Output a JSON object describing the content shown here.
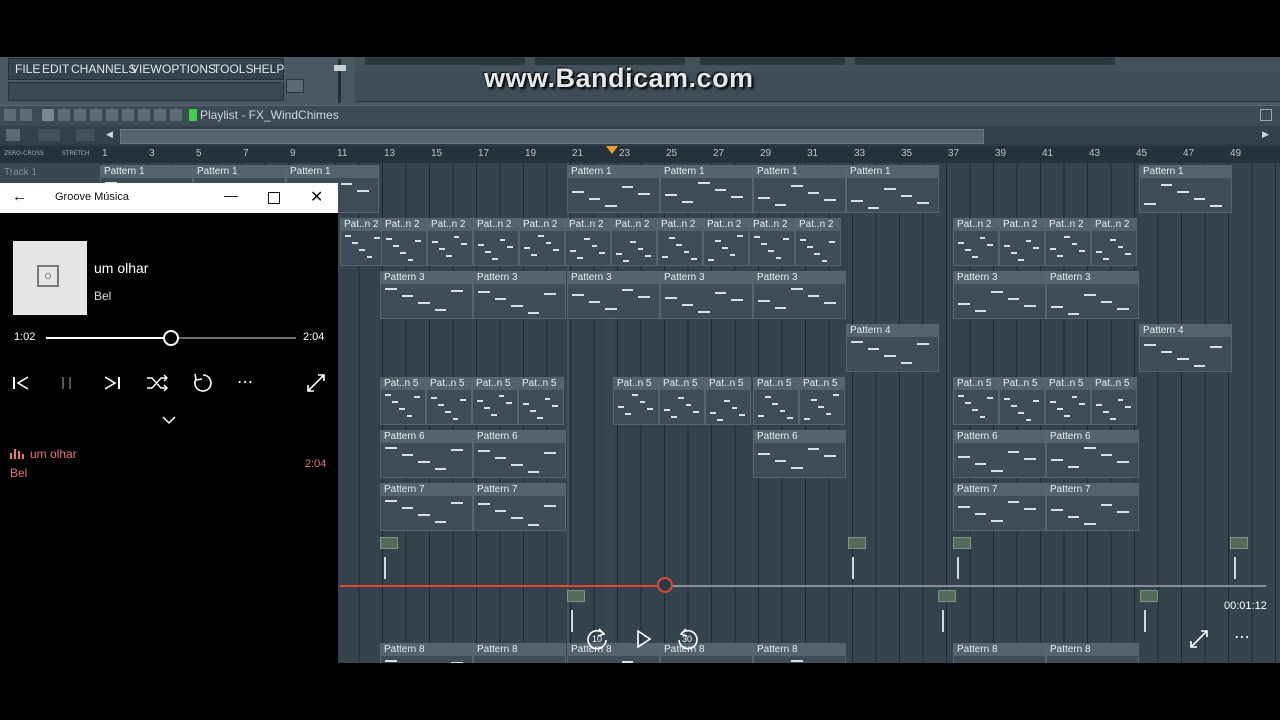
{
  "fl": {
    "menu": [
      "FILE",
      "EDIT",
      "CHANNELS",
      "VIEW",
      "OPTIONS",
      "TOOLS",
      "HELP"
    ],
    "playlist_title": "Playlist - FX_WindChimes",
    "watermark": "www.Bandicam.com",
    "track1_label": "Track 1",
    "snap_labels": [
      "ZERO-CROSS",
      "STRETCH"
    ],
    "ruler": [
      "1",
      "3",
      "5",
      "7",
      "9",
      "11",
      "13",
      "15",
      "17",
      "19",
      "21",
      "23",
      "25",
      "27",
      "29",
      "31",
      "33",
      "35",
      "37",
      "39",
      "41",
      "43",
      "45",
      "47",
      "49"
    ],
    "clips": {
      "p1": "Pattern 1",
      "p2": "Pat..n 2",
      "p3": "Pattern 3",
      "p4": "Pattern 4",
      "p5": "Pat..n 5",
      "p6": "Pattern 6",
      "p7": "Pattern 7",
      "p8": "Pattern 8"
    }
  },
  "groove": {
    "app_title": "Groove Música",
    "song_title": "um olhar",
    "artist": "Bel",
    "elapsed": "1:02",
    "duration": "2:04",
    "progress": 0.5,
    "queue": [
      {
        "title": "um olhar",
        "artist": "Bel",
        "duration": "2:04"
      }
    ]
  },
  "video": {
    "timestamp": "00:01:12",
    "skip_back": "10",
    "skip_forward": "30",
    "progress": 0.35
  },
  "colors": {
    "accent": "#e0463c",
    "queue_highlight": "#e8747a"
  }
}
